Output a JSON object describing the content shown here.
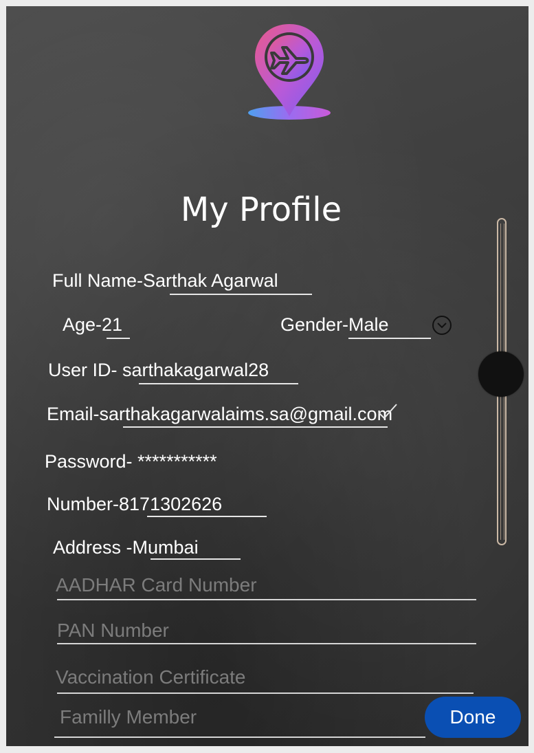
{
  "title": "My Profile",
  "fields": {
    "full_name": "Full Name-Sarthak Agarwal",
    "age": "Age-21",
    "gender": "Gender-Male",
    "user_id": "User ID- sarthakagarwal28",
    "email": "Email-sarthakagarwalaims.sa@gmail.com",
    "password": "Password- ***********",
    "number": "Number-8171302626",
    "address": "Address -Mumbai"
  },
  "placeholders": {
    "aadhar": "AADHAR Card Number",
    "pan": "PAN Number",
    "vaccination": "Vaccination Certificate",
    "family": "Familly Member"
  },
  "done_label": "Done",
  "colors": {
    "accent": "#0a4fb3",
    "logo_gradient_start": "#e0508a",
    "logo_gradient_end": "#8a5cf0"
  },
  "icons": {
    "logo": "airplane-location-pin-icon",
    "dropdown": "chevron-down-circle-icon",
    "check": "checkmark-icon"
  }
}
